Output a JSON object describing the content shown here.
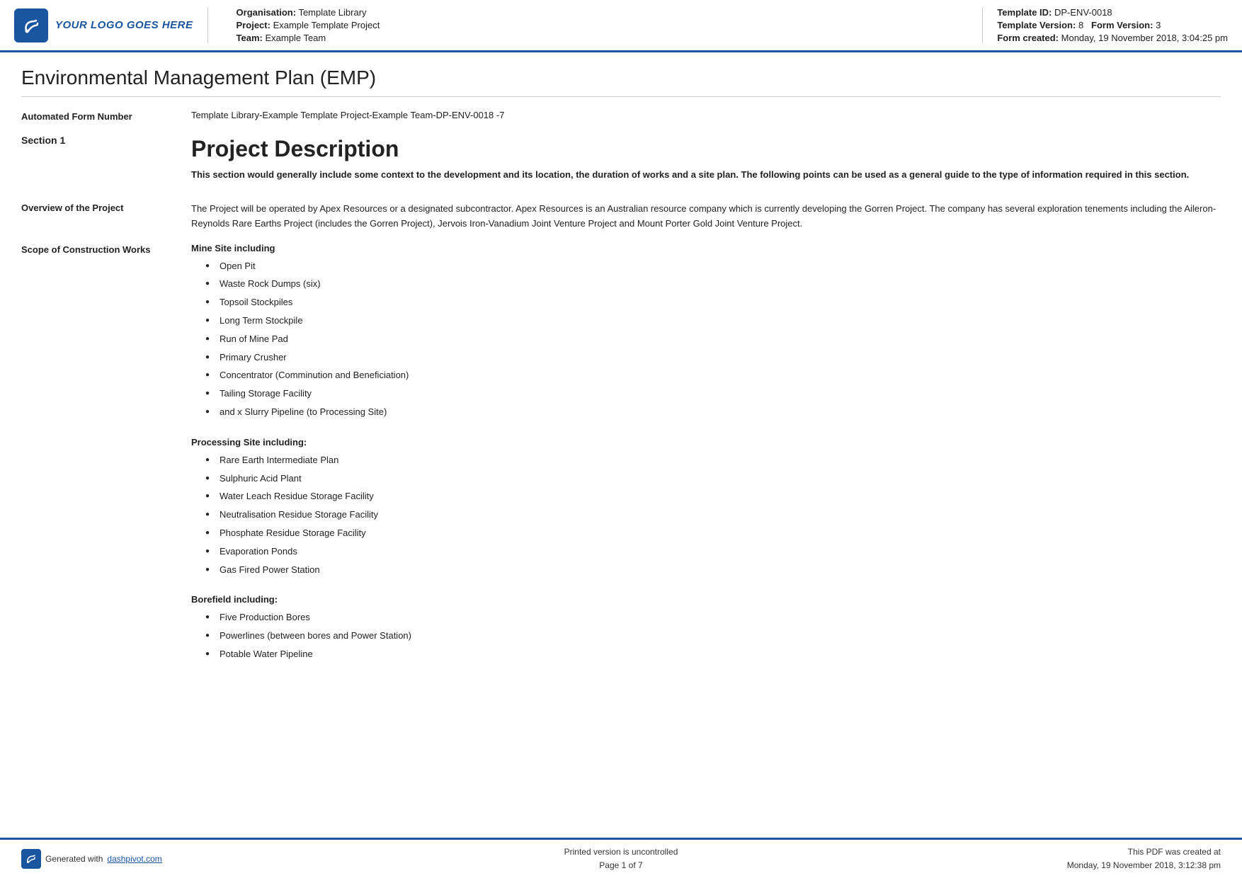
{
  "header": {
    "logo_text": "YOUR LOGO GOES HERE",
    "org_label": "Organisation:",
    "org_value": "Template Library",
    "project_label": "Project:",
    "project_value": "Example Template Project",
    "team_label": "Team:",
    "team_value": "Example Team",
    "template_id_label": "Template ID:",
    "template_id_value": "DP-ENV-0018",
    "template_version_label": "Template Version:",
    "template_version_value": "8",
    "form_version_label": "Form Version:",
    "form_version_value": "3",
    "form_created_label": "Form created:",
    "form_created_value": "Monday, 19 November 2018, 3:04:25 pm"
  },
  "page": {
    "title": "Environmental Management Plan (EMP)"
  },
  "automated_form": {
    "label": "Automated Form Number",
    "value": "Template Library-Example Template Project-Example Team-DP-ENV-0018  -7"
  },
  "section1": {
    "label": "Section 1",
    "heading": "Project Description",
    "intro": "This section would generally include some context to the development and its location, the duration of works and a site plan. The following points can be used as a general guide to the type of information required in this section."
  },
  "overview": {
    "label": "Overview of the Project",
    "text": "The Project will be operated by Apex Resources or a designated subcontractor. Apex Resources is an Australian resource company which is currently developing the Gorren Project. The company has several exploration tenements including the Aileron-Reynolds Rare Earths Project (includes the Gorren Project), Jervois Iron-Vanadium Joint Venture Project and Mount Porter Gold Joint Venture Project."
  },
  "scope": {
    "label": "Scope of Construction Works",
    "mine_site_heading": "Mine Site including",
    "mine_site_items": [
      "Open Pit",
      "Waste Rock Dumps (six)",
      "Topsoil Stockpiles",
      "Long Term Stockpile",
      "Run of Mine Pad",
      "Primary Crusher",
      "Concentrator (Comminution and Beneficiation)",
      "Tailing Storage Facility",
      "and x Slurry Pipeline (to Processing Site)"
    ],
    "processing_site_heading": "Processing Site including:",
    "processing_site_items": [
      "Rare Earth Intermediate Plan",
      "Sulphuric Acid Plant",
      "Water Leach Residue Storage Facility",
      "Neutralisation Residue Storage Facility",
      "Phosphate Residue Storage Facility",
      "Evaporation Ponds",
      "Gas Fired Power Station"
    ],
    "borefield_heading": "Borefield including:",
    "borefield_items": [
      "Five Production Bores",
      "Powerlines (between bores and Power Station)",
      "Potable Water Pipeline"
    ]
  },
  "footer": {
    "generated_label": "Generated with",
    "generated_link_text": "dashpivot.com",
    "center_line1": "Printed version is uncontrolled",
    "center_line2": "Page 1 of 7",
    "right_line1": "This PDF was created at",
    "right_line2": "Monday, 19 November 2018, 3:12:38 pm"
  }
}
